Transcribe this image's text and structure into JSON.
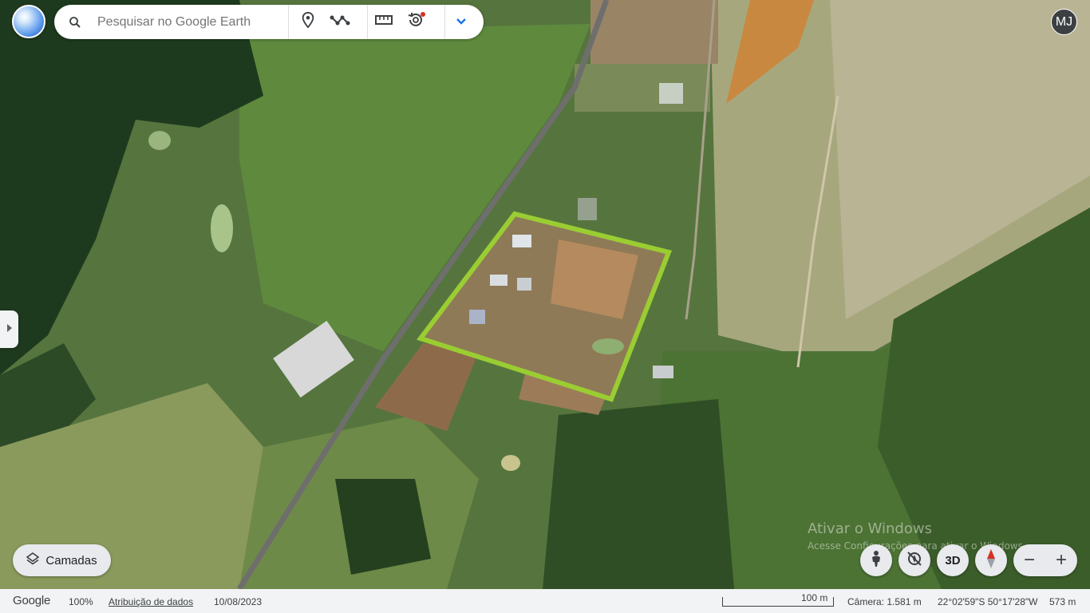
{
  "search": {
    "placeholder": "Pesquisar no Google Earth"
  },
  "toolbar": {
    "icons": [
      "search-icon",
      "place-pin-icon",
      "path-icon",
      "ruler-icon",
      "history-icon",
      "chevron-down-icon"
    ],
    "history_has_notification": true
  },
  "user": {
    "initials": "MJ"
  },
  "layers": {
    "label": "Camadas",
    "icon": "layers-icon"
  },
  "controls": {
    "three_d_label": "3D",
    "zoom_out": "−",
    "zoom_in": "+"
  },
  "watermark": {
    "line1": "Ativar o Windows",
    "line2": "Acesse Configurações para ativar o Windows."
  },
  "status": {
    "logo": "Google",
    "zoom": "100%",
    "attribution": "Atribuição de dados",
    "date": "10/08/2023",
    "scale": "100 m",
    "camera": "Câmera: 1.581 m",
    "coordinates": "22°02'59\"S 50°17'28\"W",
    "elevation": "573 m"
  },
  "colors": {
    "polygon": "#9acd32",
    "accent": "#1a73e8",
    "notification": "#d93025"
  }
}
